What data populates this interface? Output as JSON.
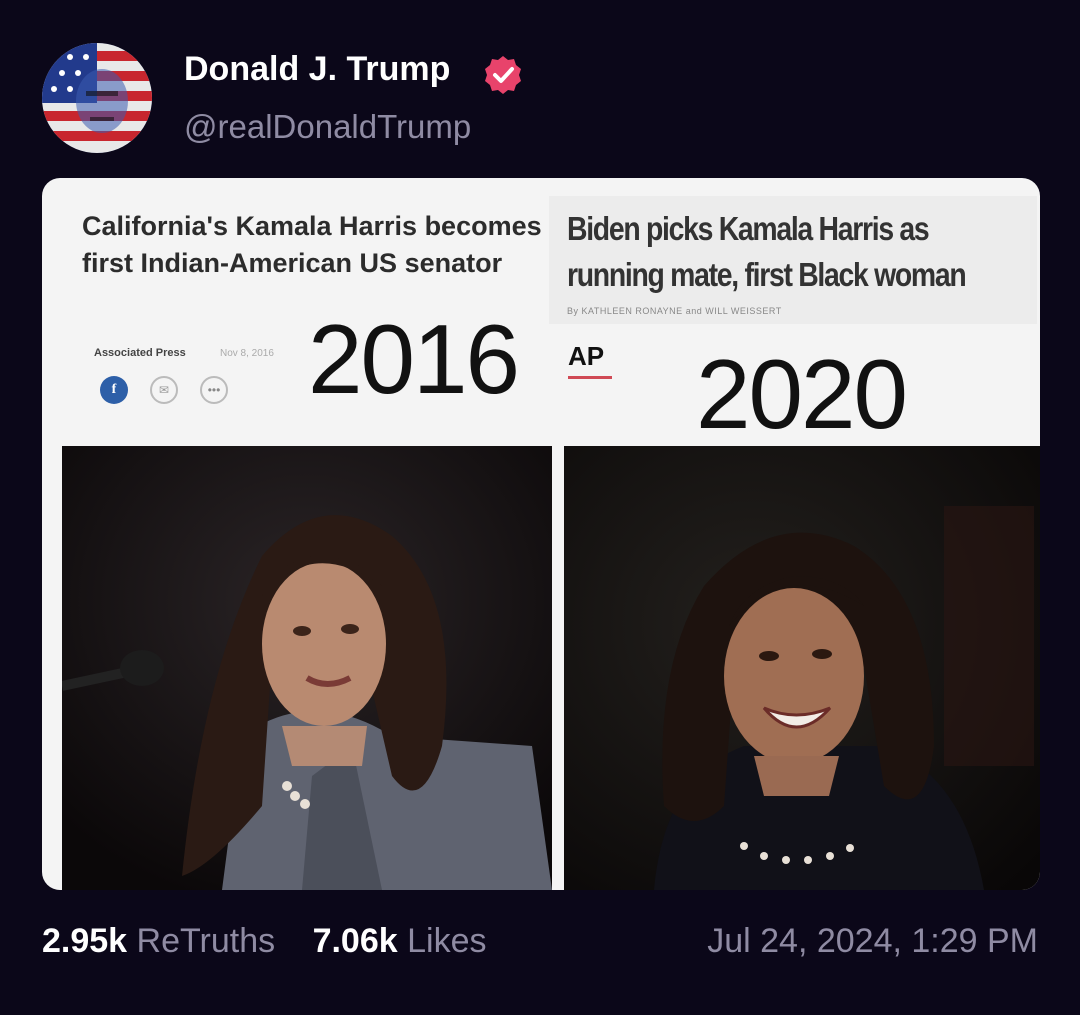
{
  "post": {
    "author_name": "Donald J. Trump",
    "author_handle": "@realDonaldTrump",
    "verified_icon": "verified-badge-icon",
    "timestamp": "Jul 24, 2024, 1:29 PM"
  },
  "stats": {
    "retruths_count": "2.95k",
    "retruths_label": "ReTruths",
    "likes_count": "7.06k",
    "likes_label": "Likes"
  },
  "media": {
    "left_headline": "California's Kamala Harris becomes first Indian-American US senator",
    "left_source": "Associated Press",
    "left_date": "Nov 8, 2016",
    "left_year": "2016",
    "right_source": "AP",
    "right_headline": "Biden picks Kamala Harris as running mate, first Black woman",
    "right_byline": "By KATHLEEN RONAYNE and WILL WEISSERT",
    "right_year": "2020",
    "share_icons": [
      "facebook-icon",
      "mail-icon",
      "more-icon"
    ]
  },
  "colors": {
    "background": "#0b0719",
    "muted_text": "#8f8ba3",
    "verified": "#e8436b"
  }
}
